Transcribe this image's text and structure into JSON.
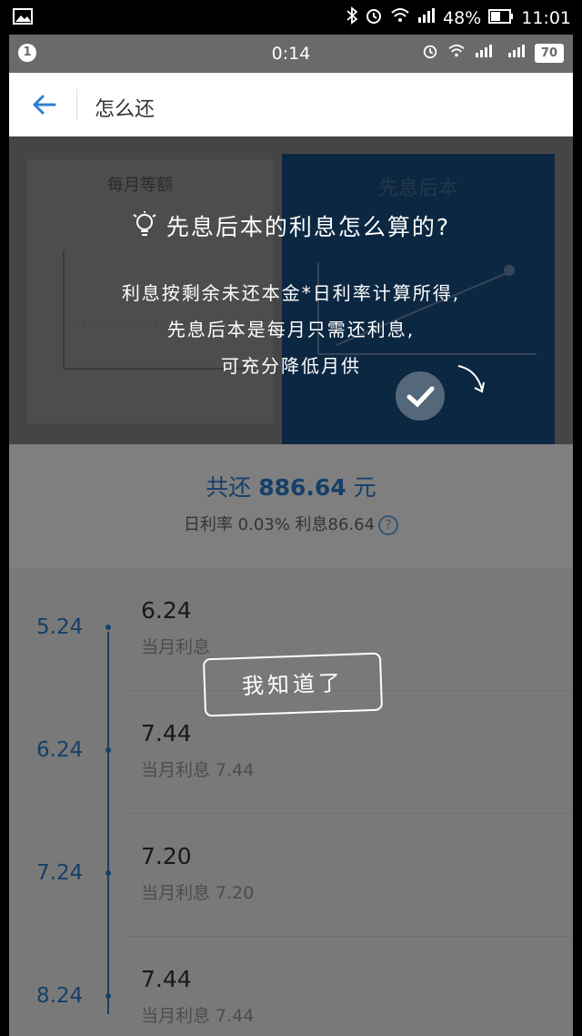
{
  "device_status": {
    "battery": "48%",
    "time": "11:01"
  },
  "inner_status": {
    "time": "0:14",
    "battery": "70"
  },
  "header": {
    "title": "怎么还"
  },
  "diagram": {
    "card1_title": "每月等额",
    "card2_title": "先息后本"
  },
  "summary": {
    "total_prefix": "共还 ",
    "total_amount": "886.64",
    "total_suffix": " 元",
    "rate_text": "日利率 0.03% 利息86.64",
    "help_icon": "?"
  },
  "schedule": {
    "rows": [
      {
        "date": "5.24",
        "amount": "6.24",
        "sub": "当月利息"
      },
      {
        "date": "6.24",
        "amount": "7.44",
        "sub": "当月利息 7.44"
      },
      {
        "date": "7.24",
        "amount": "7.20",
        "sub": "当月利息 7.20"
      },
      {
        "date": "8.24",
        "amount": "7.44",
        "sub": "当月利息 7.44"
      }
    ]
  },
  "overlay": {
    "question": "先息后本的利息怎么算的?",
    "line1": "利息按剩余未还本金*日利率计算所得,",
    "line2": "先息后本是每月只需还利息,",
    "line3": "可充分降低月供",
    "button": "我知道了"
  },
  "colors": {
    "accent": "#2c7fd0",
    "card_blue": "#184e82"
  }
}
